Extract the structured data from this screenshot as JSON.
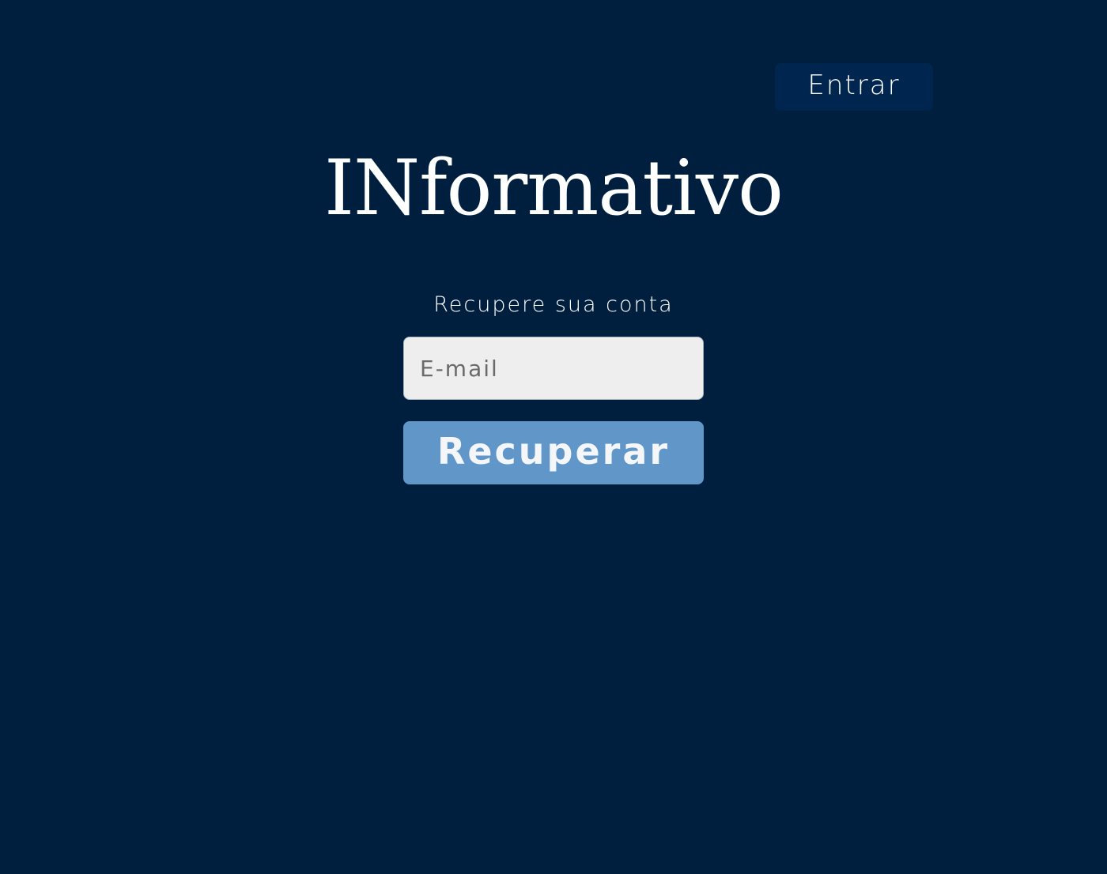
{
  "header": {
    "login_label": "Entrar"
  },
  "brand": {
    "logo_text": "INformativo"
  },
  "recovery_form": {
    "subtitle": "Recupere sua conta",
    "email_placeholder": "E-mail",
    "email_value": "",
    "submit_label": "Recuperar"
  },
  "colors": {
    "background": "#001f3f",
    "login_button_bg": "#00264f",
    "submit_button_bg": "#6196c9",
    "input_bg": "#eeeeee",
    "text": "#ffffff"
  }
}
